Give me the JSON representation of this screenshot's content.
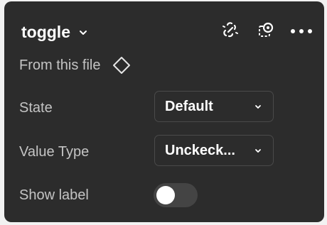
{
  "panel": {
    "title": "toggle",
    "actions": [
      {
        "icon": "detach-instance-icon"
      },
      {
        "icon": "go-to-main-component-icon"
      },
      {
        "icon": "more-options-icon"
      }
    ]
  },
  "source": {
    "label": "From this file",
    "icon": "component-diamond-icon"
  },
  "properties": [
    {
      "label": "State",
      "type": "dropdown",
      "value": "Default"
    },
    {
      "label": "Value Type",
      "type": "dropdown",
      "value": "Unckeck..."
    },
    {
      "label": "Show label",
      "type": "toggle",
      "checked": false
    }
  ]
}
